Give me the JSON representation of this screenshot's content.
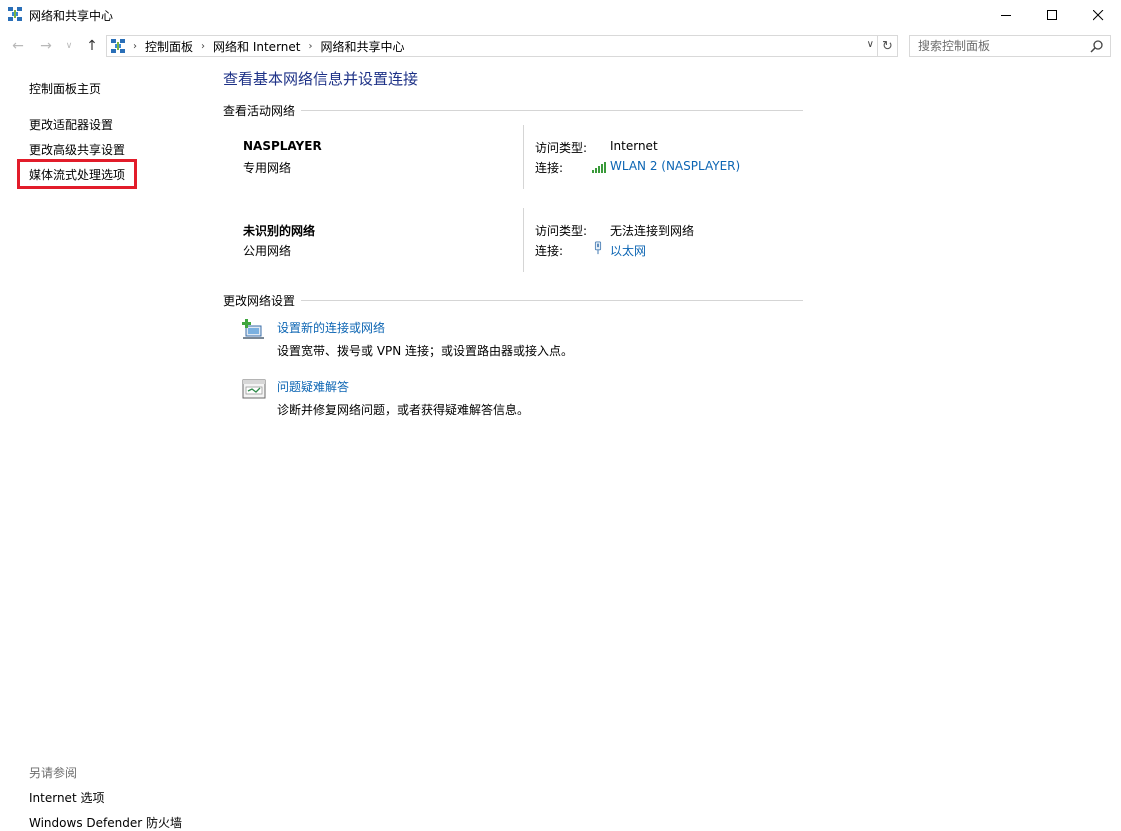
{
  "window": {
    "title": "网络和共享中心"
  },
  "address_bar": {
    "breadcrumbs": [
      "控制面板",
      "网络和 Internet",
      "网络和共享中心"
    ],
    "search_placeholder": "搜索控制面板"
  },
  "left_pane": {
    "home": "控制面板主页",
    "links": [
      "更改适配器设置",
      "更改高级共享设置",
      "媒体流式处理选项"
    ],
    "see_also_header": "另请参阅",
    "see_also": [
      "Internet 选项",
      "Windows Defender 防火墙"
    ]
  },
  "main": {
    "title": "查看基本网络信息并设置连接",
    "active_networks_header": "查看活动网络",
    "networks": [
      {
        "name": "NASPLAYER",
        "type": "专用网络",
        "access_label": "访问类型:",
        "access_value": "Internet",
        "connection_label": "连接:",
        "connection_value": "WLAN 2 (NASPLAYER)",
        "connection_icon": "wifi-signal-icon"
      },
      {
        "name": "未识别的网络",
        "type": "公用网络",
        "access_label": "访问类型:",
        "access_value": "无法连接到网络",
        "connection_label": "连接:",
        "connection_value": "以太网",
        "connection_icon": "ethernet-icon"
      }
    ],
    "change_settings_header": "更改网络设置",
    "tasks": [
      {
        "link": "设置新的连接或网络",
        "desc": "设置宽带、拨号或 VPN 连接；或设置路由器或接入点。",
        "icon": "new-connection-icon"
      },
      {
        "link": "问题疑难解答",
        "desc": "诊断并修复网络问题，或者获得疑难解答信息。",
        "icon": "troubleshoot-icon"
      }
    ]
  },
  "colors": {
    "link": "#0c65b3",
    "title": "#1e3287",
    "highlight_box": "#e21c2a"
  }
}
